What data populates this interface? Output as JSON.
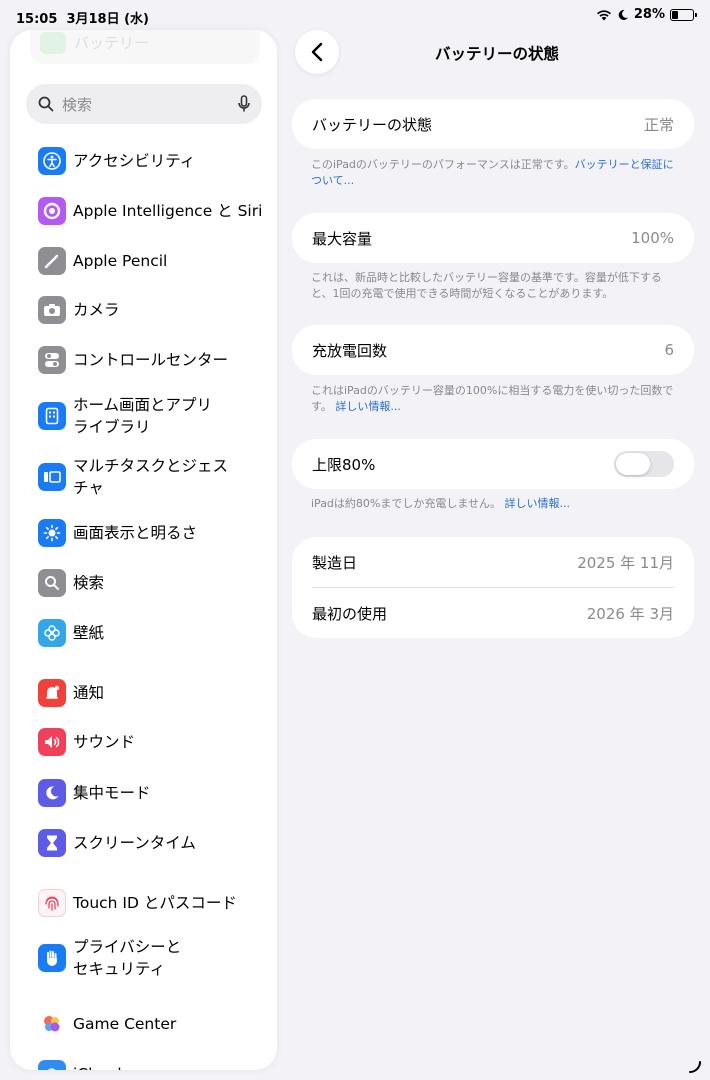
{
  "status_bar": {
    "time": "15:05",
    "date": "3月18日 (水)",
    "battery_percent": "28%",
    "battery_level": 0.28
  },
  "sidebar": {
    "ghost_item_label": "バッテリー",
    "search_placeholder": "検索",
    "items": [
      {
        "label": "アクセシビリティ",
        "icon": "accessibility-icon",
        "color": "#1a7cf5"
      },
      {
        "label": "Apple Intelligence と Siri",
        "icon": "siri-icon",
        "color": "#b45af2"
      },
      {
        "label": "Apple Pencil",
        "icon": "pencil-icon",
        "color": "#8e8e93"
      },
      {
        "label": "カメラ",
        "icon": "camera-icon",
        "color": "#8e8e93"
      },
      {
        "label": "コントロールセンター",
        "icon": "control-center-icon",
        "color": "#8e8e93"
      },
      {
        "label": "ホーム画面とアプリ\nライブラリ",
        "icon": "home-screen-icon",
        "color": "#1a7cf5"
      },
      {
        "label": "マルチタスクとジェス\nチャ",
        "icon": "multitasking-icon",
        "color": "#1a7cf5"
      },
      {
        "label": "画面表示と明るさ",
        "icon": "brightness-icon",
        "color": "#1a7cf5"
      },
      {
        "label": "検索",
        "icon": "search-icon",
        "color": "#8e8e93"
      },
      {
        "label": "壁紙",
        "icon": "wallpaper-icon",
        "color": "#35a7e8"
      },
      {
        "label": "通知",
        "icon": "notifications-icon",
        "color": "#f2403b"
      },
      {
        "label": "サウンド",
        "icon": "sound-icon",
        "color": "#f2405a"
      },
      {
        "label": "集中モード",
        "icon": "focus-moon-icon",
        "color": "#5e5ce6"
      },
      {
        "label": "スクリーンタイム",
        "icon": "hourglass-icon",
        "color": "#5e5ce6"
      },
      {
        "label": "Touch ID とパスコード",
        "icon": "fingerprint-icon",
        "color": "#f2405a"
      },
      {
        "label": "プライバシーと\nセキュリティ",
        "icon": "privacy-hand-icon",
        "color": "#1a7cf5"
      },
      {
        "label": "Game Center",
        "icon": "game-center-icon",
        "color": "#f25a8c"
      },
      {
        "label": "iCloud",
        "icon": "icloud-icon",
        "color": "#2f8cf0"
      }
    ]
  },
  "main": {
    "title": "バッテリーの状態",
    "battery_state": {
      "label": "バッテリーの状態",
      "value": "正常"
    },
    "battery_state_note": "このiPadのバッテリーのパフォーマンスは正常です。",
    "battery_state_link": "バッテリーと保証について...",
    "max_capacity": {
      "label": "最大容量",
      "value": "100%"
    },
    "max_capacity_note": "これは、新品時と比較したバッテリー容量の基準です。容量が低下すると、1回の充電で使用できる時間が短くなることがあります。",
    "cycle_count": {
      "label": "充放電回数",
      "value": "6"
    },
    "cycle_count_note": "これはiPadのバッテリー容量の100%に相当する電力を使い切った回数です。",
    "cycle_count_link": "詳しい情報...",
    "limit": {
      "label": "上限80%",
      "enabled": false
    },
    "limit_note": "iPadは約80%までしか充電しません。",
    "limit_link": "詳しい情報...",
    "manufacture": {
      "label": "製造日",
      "value": "2025 年 11月"
    },
    "first_use": {
      "label": "最初の使用",
      "value": "2026 年 3月"
    }
  }
}
